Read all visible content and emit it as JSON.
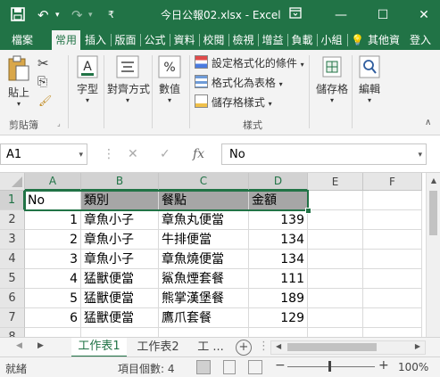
{
  "titlebar": {
    "title": "今日公報02.xlsx - Excel",
    "save_icon": "save-icon",
    "undo_icon": "undo-icon",
    "redo_icon": "redo-icon",
    "customize_icon": "customize-icon",
    "ribbon_display_icon": "ribbon-display-icon",
    "minimize": "—",
    "restore": "☐",
    "close": "✕"
  },
  "tabs": [
    "檔案",
    "常用",
    "插入",
    "版面",
    "公式",
    "資料",
    "校閱",
    "檢視",
    "增益",
    "負載",
    "小組"
  ],
  "active_tab": "常用",
  "tell_me": "其他資",
  "signin": "登入",
  "ribbon": {
    "paste": "貼上",
    "clipboard_label": "剪貼簿",
    "font": "字型",
    "alignment": "對齊方式",
    "number": "數值",
    "cond_format": "設定格式化的條件",
    "format_table": "格式化為表格",
    "cell_styles": "儲存格樣式",
    "styles_label": "樣式",
    "cells": "儲存格",
    "editing": "編輯"
  },
  "formula_bar": {
    "name_box": "A1",
    "fx": "fx",
    "value": "No"
  },
  "grid": {
    "columns": [
      "A",
      "B",
      "C",
      "D",
      "E",
      "F"
    ],
    "rows": [
      "1",
      "2",
      "3",
      "4",
      "5",
      "6",
      "7",
      "8"
    ],
    "header_row": [
      "No",
      "類別",
      "餐點",
      "金額"
    ],
    "data": [
      [
        "1",
        "章魚小子",
        "章魚丸便當",
        "139"
      ],
      [
        "2",
        "章魚小子",
        "牛排便當",
        "134"
      ],
      [
        "3",
        "章魚小子",
        "章魚燒便當",
        "134"
      ],
      [
        "4",
        "猛獸便當",
        "鯊魚煙套餐",
        "111"
      ],
      [
        "5",
        "猛獸便當",
        "熊掌漢堡餐",
        "189"
      ],
      [
        "6",
        "猛獸便當",
        "鷹爪套餐",
        "129"
      ]
    ]
  },
  "sheets": {
    "tabs": [
      "工作表1",
      "工作表2",
      "工 ..."
    ],
    "active": "工作表1"
  },
  "status": {
    "ready": "就緒",
    "count": "項目個數: 4",
    "zoom": "100%"
  }
}
